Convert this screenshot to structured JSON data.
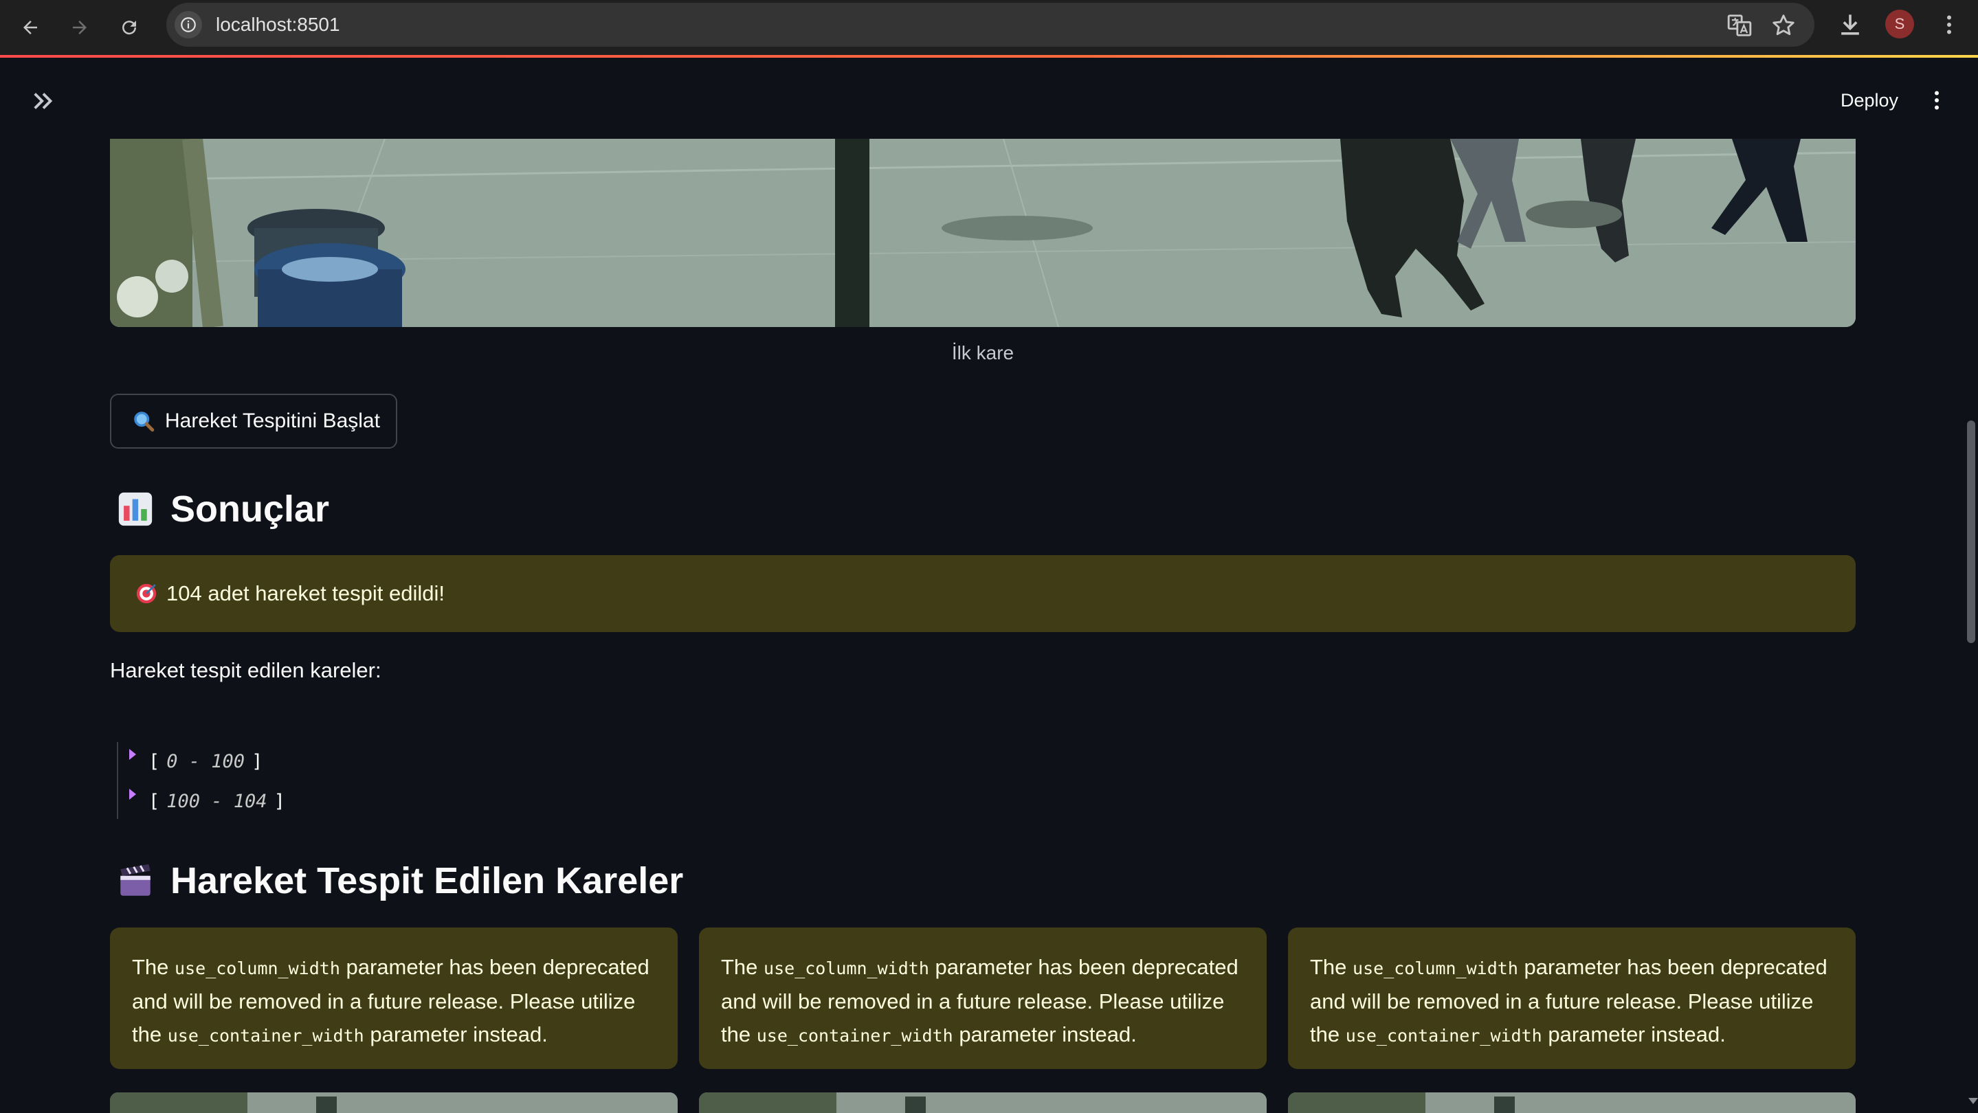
{
  "browser": {
    "url": "localhost:8501",
    "avatar_letter": "S"
  },
  "header": {
    "deploy_label": "Deploy"
  },
  "first_frame": {
    "caption": "İlk kare"
  },
  "start_button": {
    "label": "Hareket Tespitini Başlat"
  },
  "results": {
    "title": "Sonuçlar",
    "alert_text": "104 adet hareket tespit edildi!",
    "detected_label": "Hareket tespit edilen kareler:",
    "json_ranges": [
      {
        "open": "[",
        "range": "0 - 100",
        "close": "]"
      },
      {
        "open": "[",
        "range": "100 - 104",
        "close": "]"
      }
    ]
  },
  "frames_section": {
    "title": "Hareket Tespit Edilen Kareler",
    "warning": {
      "prefix": "The",
      "param_old": "use_column_width",
      "middle": "parameter has been deprecated and will be removed in a future release. Please utilize the",
      "param_new": "use_container_width",
      "suffix": "parameter instead."
    }
  },
  "colors": {
    "background": "#0e1117",
    "warning_bg": "#3f3c16",
    "accent_red": "#ff4b4b"
  }
}
